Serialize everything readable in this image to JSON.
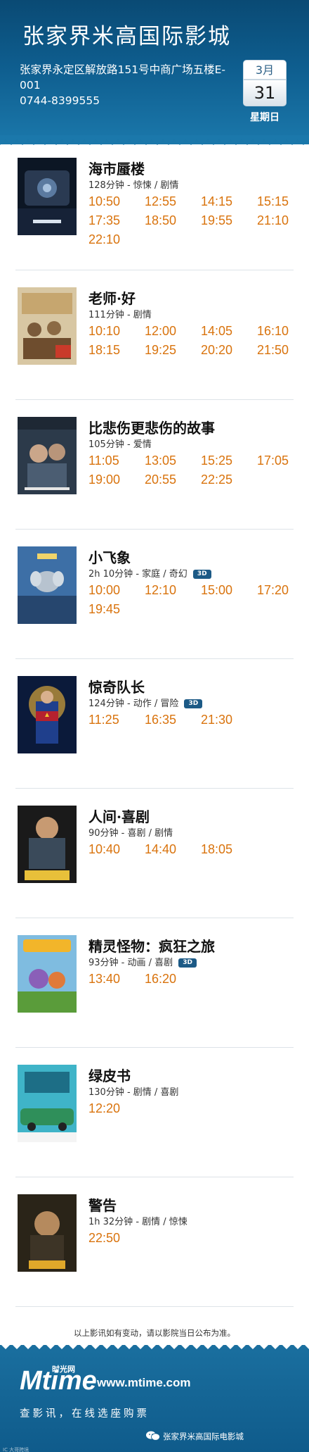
{
  "header": {
    "cinema_name": "张家界米高国际影城",
    "address": "张家界永定区解放路151号中商广场五楼E-001",
    "phone": "0744-8399555",
    "date": {
      "month": "3月",
      "day": "31",
      "weekday": "星期日"
    }
  },
  "movies": [
    {
      "title": "海市蜃楼",
      "info": "128分钟 - 惊悚 / 剧情",
      "is_3d": false,
      "times": [
        "10:50",
        "12:55",
        "14:15",
        "15:15",
        "17:35",
        "18:50",
        "19:55",
        "21:10",
        "22:10"
      ]
    },
    {
      "title": "老师·好",
      "info": "111分钟 - 剧情",
      "is_3d": false,
      "times": [
        "10:10",
        "12:00",
        "14:05",
        "16:10",
        "18:15",
        "19:25",
        "20:20",
        "21:50"
      ]
    },
    {
      "title": "比悲伤更悲伤的故事",
      "info": "105分钟 - 爱情",
      "is_3d": false,
      "times": [
        "11:05",
        "13:05",
        "15:25",
        "17:05",
        "19:00",
        "20:55",
        "22:25"
      ]
    },
    {
      "title": "小飞象",
      "info": "2h 10分钟 - 家庭 / 奇幻",
      "is_3d": true,
      "times": [
        "10:00",
        "12:10",
        "15:00",
        "17:20",
        "19:45"
      ]
    },
    {
      "title": "惊奇队长",
      "info": "124分钟 - 动作 / 冒险",
      "is_3d": true,
      "times": [
        "11:25",
        "16:35",
        "21:30"
      ]
    },
    {
      "title": "人间·喜剧",
      "info": "90分钟 - 喜剧 / 剧情",
      "is_3d": false,
      "times": [
        "10:40",
        "14:40",
        "18:05"
      ]
    },
    {
      "title": "精灵怪物：疯狂之旅",
      "info": "93分钟 - 动画 / 喜剧",
      "is_3d": true,
      "times": [
        "13:40",
        "16:20"
      ]
    },
    {
      "title": "绿皮书",
      "info": "130分钟 - 剧情 / 喜剧",
      "is_3d": false,
      "times": [
        "12:20"
      ]
    },
    {
      "title": "警告",
      "info": "1h 32分钟 - 剧情 / 惊悚",
      "is_3d": false,
      "times": [
        "22:50"
      ]
    }
  ],
  "badge_3d": "3D",
  "notice": "以上影讯如有变动，请以影院当日公布为准。",
  "footer": {
    "logo": "Mtime",
    "logo_cn": "时光网",
    "url": "www.mtime.com",
    "slogan": "查影讯，在线选座购票",
    "wechat_label": "张家界米高国际电影城",
    "watermark": "IC 大哥跨境"
  },
  "colors": {
    "header_bg": "#0e5d8e",
    "showtime": "#d9730d",
    "badge_bg": "#1c5a86"
  }
}
